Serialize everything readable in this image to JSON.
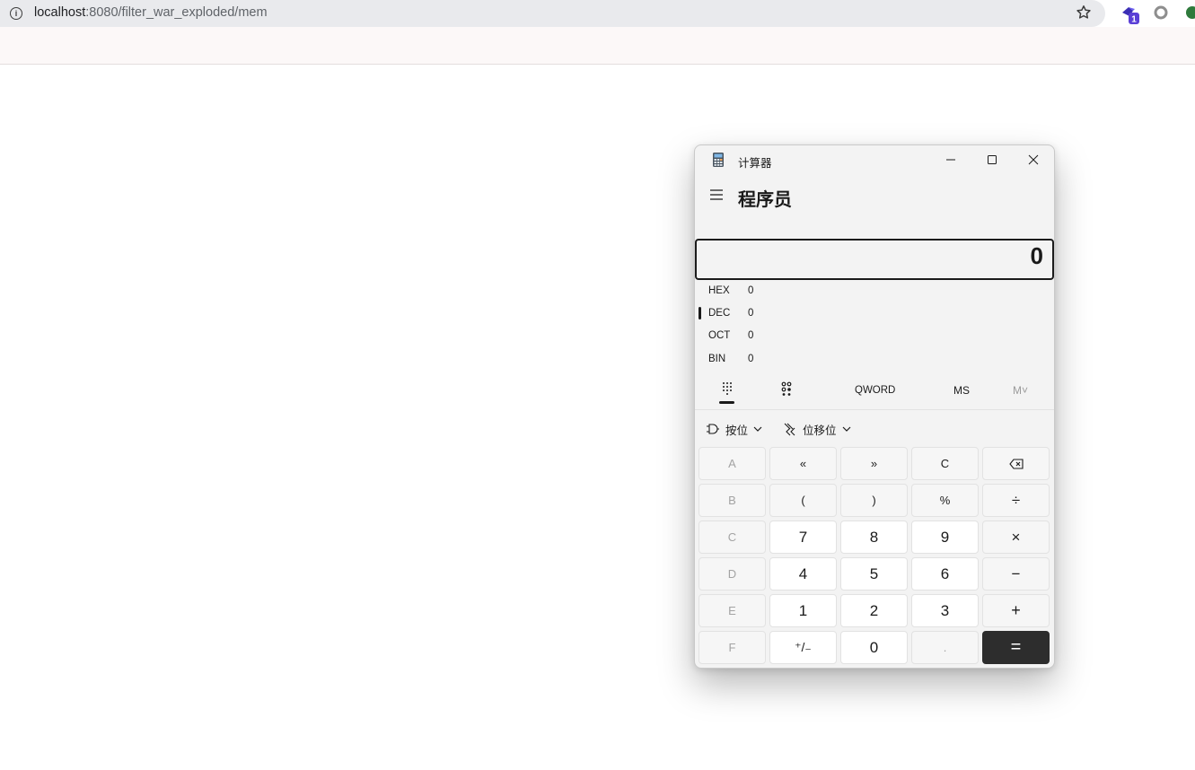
{
  "browser": {
    "url_host": "localhost",
    "url_rest": ":8080/filter_war_exploded/mem",
    "extension_badge": "1"
  },
  "calculator": {
    "window_title": "计算器",
    "mode_title": "程序员",
    "display_value": "0",
    "radix": [
      {
        "label": "HEX",
        "value": "0",
        "active": false
      },
      {
        "label": "DEC",
        "value": "0",
        "active": true
      },
      {
        "label": "OCT",
        "value": "0",
        "active": false
      },
      {
        "label": "BIN",
        "value": "0",
        "active": false
      }
    ],
    "word_size": "QWORD",
    "memory_store": "MS",
    "memory_recall": "M˅",
    "bitwise_label": "按位",
    "shift_label": "位移位",
    "keys": [
      [
        "A",
        "«",
        "»",
        "C",
        "⌫"
      ],
      [
        "B",
        "(",
        ")",
        "%",
        "÷"
      ],
      [
        "C",
        "7",
        "8",
        "9",
        "×"
      ],
      [
        "D",
        "4",
        "5",
        "6",
        "−"
      ],
      [
        "E",
        "1",
        "2",
        "3",
        "+"
      ],
      [
        "F",
        "⁺/₋",
        "0",
        ".",
        "="
      ]
    ],
    "accent_color": "#2d2d2d"
  }
}
